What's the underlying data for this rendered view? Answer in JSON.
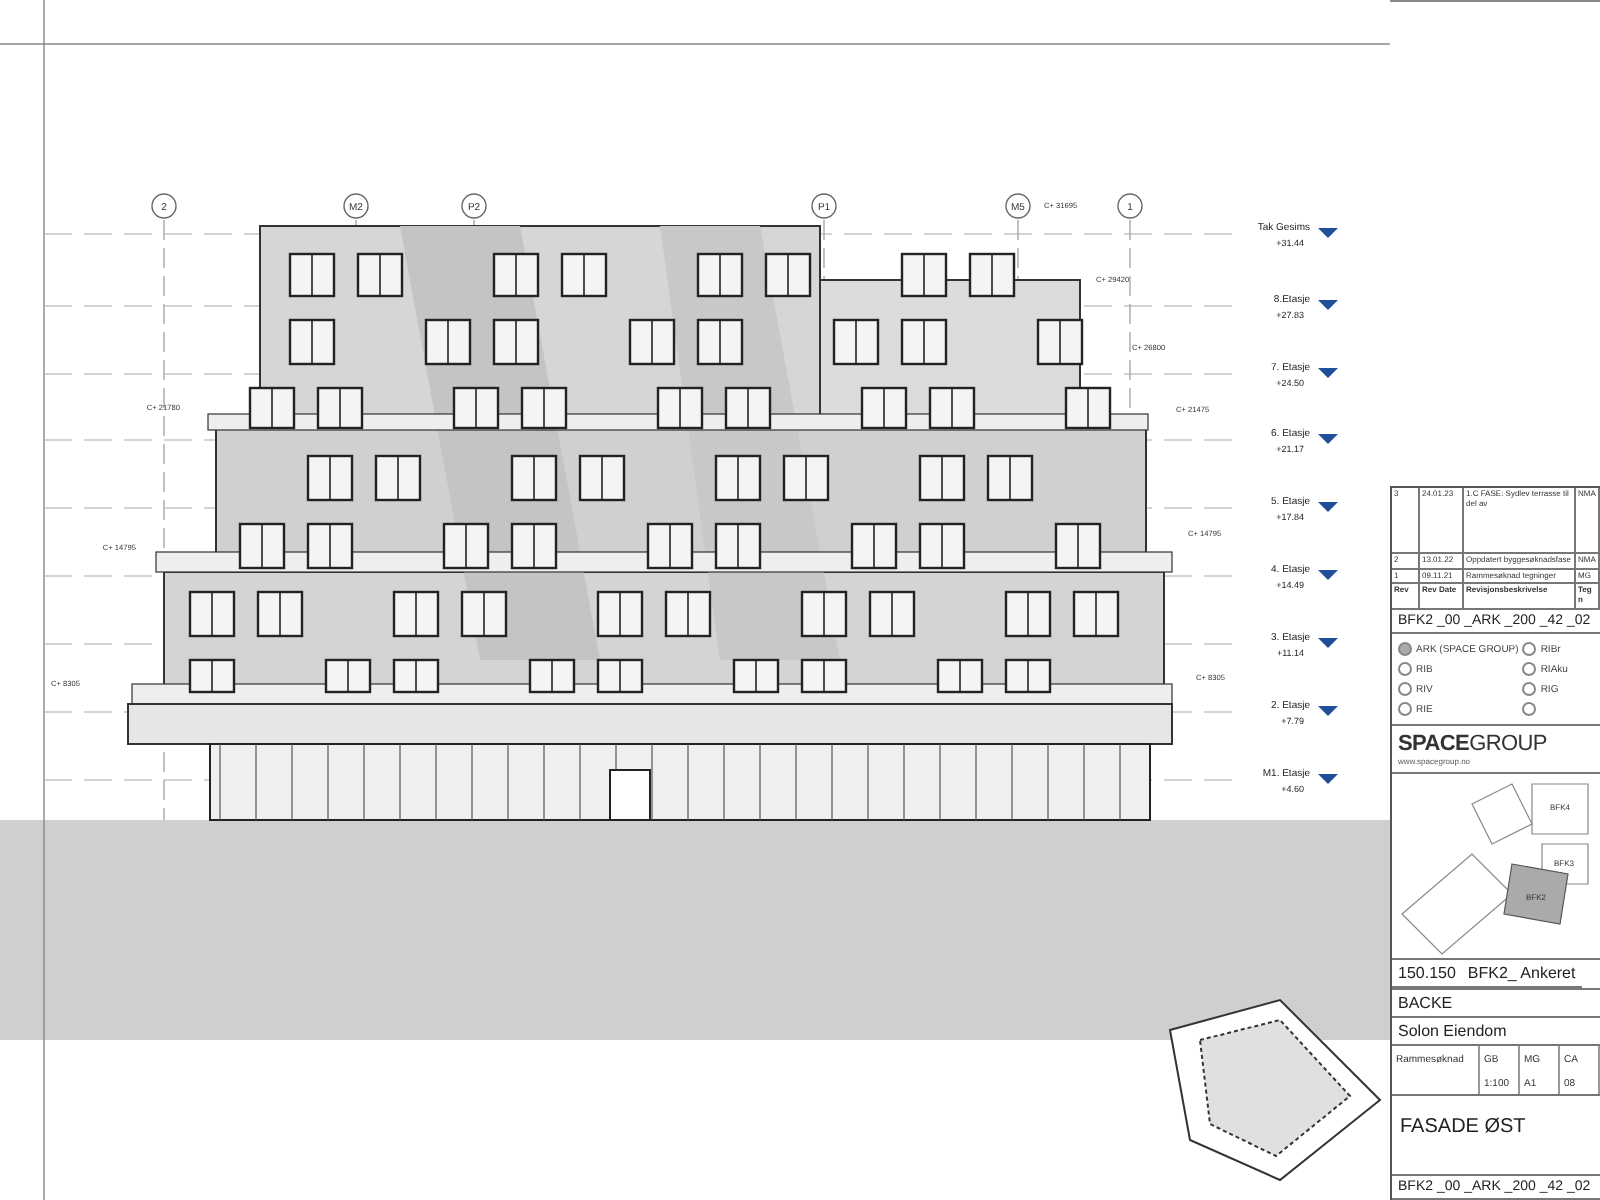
{
  "grid_lines": [
    {
      "label": "2"
    },
    {
      "label": "M2"
    },
    {
      "label": "P2"
    },
    {
      "label": "P1"
    },
    {
      "label": "M5"
    },
    {
      "label": "1"
    }
  ],
  "levels": [
    {
      "name": "Tak Gesims",
      "elevation": "+31.44"
    },
    {
      "name": "8.Etasje",
      "elevation": "+27.83"
    },
    {
      "name": "7. Etasje",
      "elevation": "+24.50"
    },
    {
      "name": "6. Etasje",
      "elevation": "+21.17"
    },
    {
      "name": "5. Etasje",
      "elevation": "+17.84"
    },
    {
      "name": "4. Etasje",
      "elevation": "+14.49"
    },
    {
      "name": "3. Etasje",
      "elevation": "+11.14"
    },
    {
      "name": "2. Etasje",
      "elevation": "+7.79"
    },
    {
      "name": "M1. Etasje",
      "elevation": "+4.60"
    }
  ],
  "height_notes": [
    {
      "text": "C+ 31695"
    },
    {
      "text": "C+ 29420"
    },
    {
      "text": "C+ 26800"
    },
    {
      "text": "C+ 21475"
    },
    {
      "text": "C+ 14795"
    },
    {
      "text": "C+ 8305"
    },
    {
      "text": "C+ 21780"
    },
    {
      "text": "C+ 14795"
    },
    {
      "text": "C+ 8305"
    }
  ],
  "title_block": {
    "revision_columns": [
      "Rev",
      "Rev Date",
      "Revisjonsbeskrivelse",
      "Tegn"
    ],
    "revisions": [
      {
        "rev": "3",
        "date": "24.01.23",
        "description": "1.C FASE: Sydlev terrasse til del av",
        "drawn_by": "NMA"
      },
      {
        "rev": "2",
        "date": "13.01.22",
        "description": "Oppdatert byggesøknadsfase",
        "drawn_by": "NMA"
      },
      {
        "rev": "1",
        "date": "09.11.21",
        "description": "Rammesøknad tegninger",
        "drawn_by": "MG"
      }
    ],
    "drawing_number": "BFK2 _00 _ARK _200 _42 _02",
    "disciplines": [
      {
        "label": "ARK (SPACE GROUP)",
        "selected": true
      },
      {
        "label": "RIBr",
        "selected": false
      },
      {
        "label": "RIB",
        "selected": false
      },
      {
        "label": "RIAku",
        "selected": false
      },
      {
        "label": "RIV",
        "selected": false
      },
      {
        "label": "RIG",
        "selected": false
      },
      {
        "label": "RIE",
        "selected": false
      },
      {
        "selected": false
      }
    ],
    "company": {
      "logo_bold": "SPACE",
      "logo_light": "GROUP",
      "website": "www.spacegroup.no"
    },
    "site_plan_labels": [
      "BFK4",
      "BFK3",
      "BFK2"
    ],
    "project_number": "150.150",
    "project_name": "BFK2_ Ankeret",
    "client": "BACKE",
    "owner": "Solon Eiendom",
    "info_rows": [
      [
        "Rammesøknad",
        "GB",
        "MG",
        "CA"
      ],
      [
        "",
        "1:100",
        "A1",
        "08"
      ]
    ],
    "drawing_title": "FASADE ØST",
    "drawing_number_bottom": "BFK2 _00 _ARK _200 _42 _02"
  }
}
